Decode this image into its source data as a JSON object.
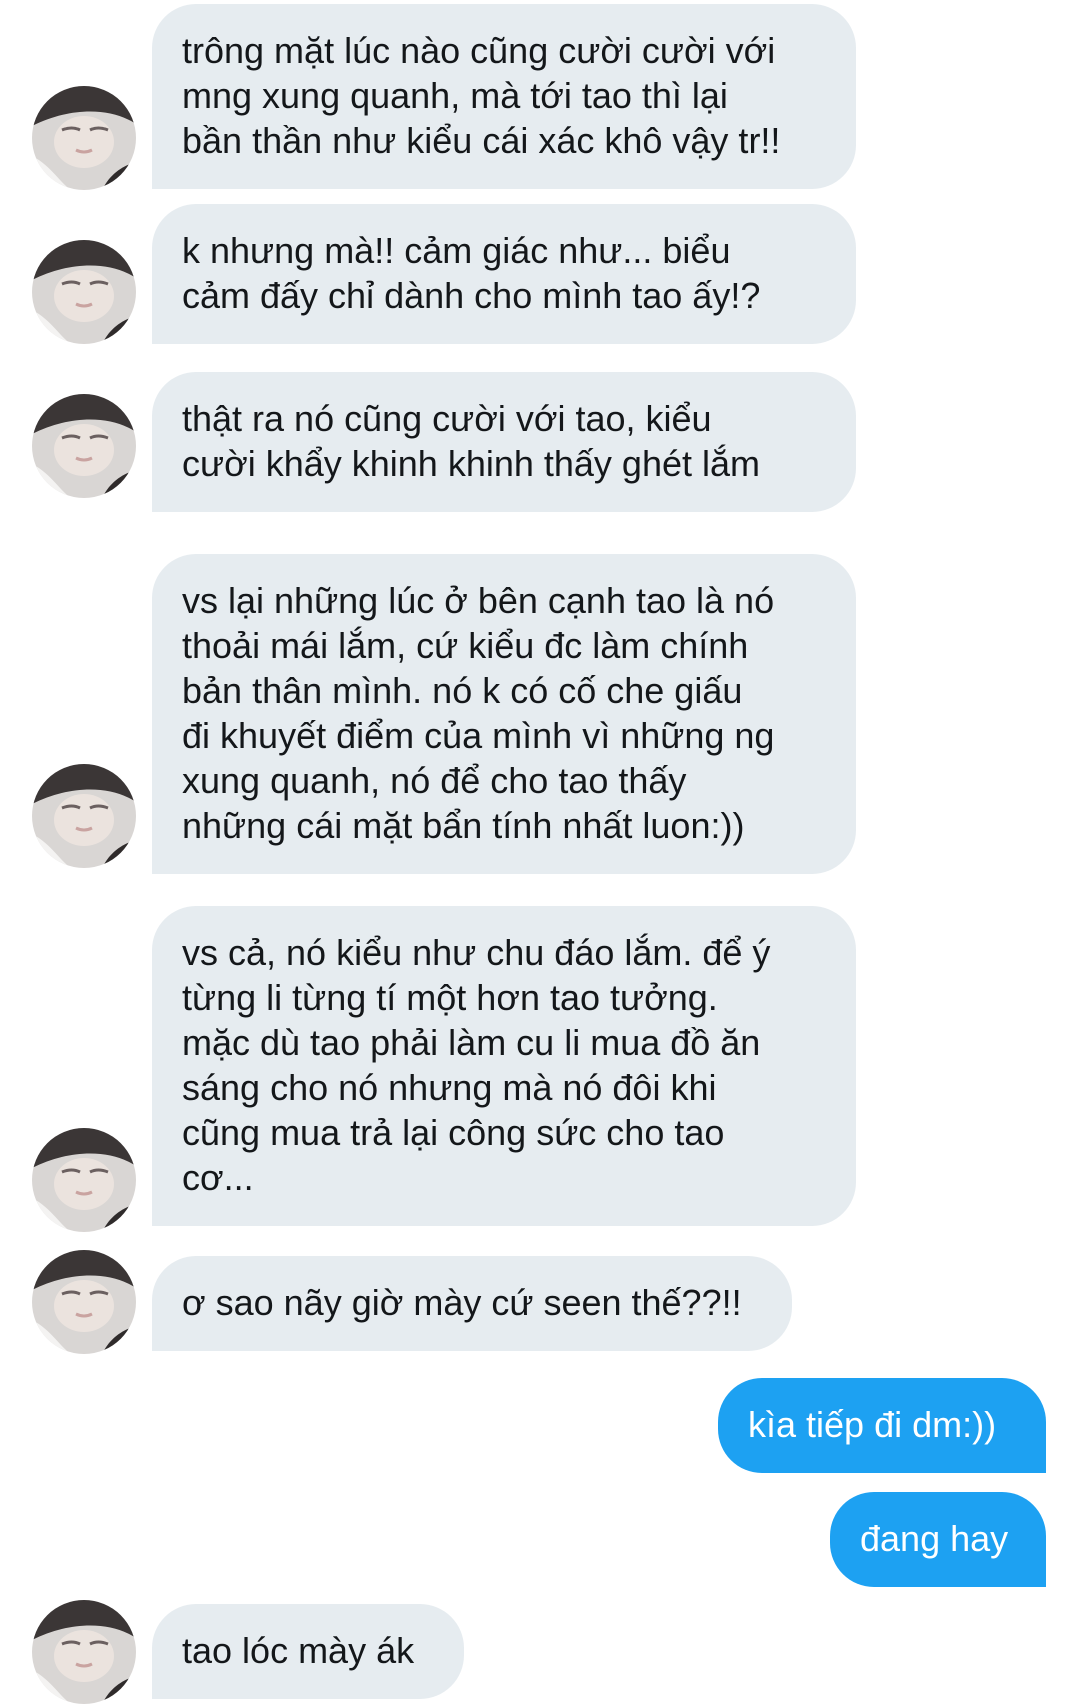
{
  "conversation": {
    "messages": [
      {
        "direction": "received",
        "text": "trông mặt lúc nào cũng cười cười với\nmng xung quanh, mà tới tao thì lại\nbần thần như kiểu cái xác khô vậy tr!!"
      },
      {
        "direction": "received",
        "text": "k nhưng mà!! cảm giác như... biểu\ncảm đấy chỉ dành cho mình tao ấy!?"
      },
      {
        "direction": "received",
        "text": "thật ra nó cũng cười với tao, kiểu\ncười khẩy khinh khinh thấy ghét lắm"
      },
      {
        "direction": "received",
        "text": "vs lại những lúc ở bên cạnh tao là nó\nthoải mái lắm, cứ kiểu đc làm chính\nbản thân mình. nó k có cố che giấu\nđi khuyết điểm của mình vì những ng\nxung quanh, nó để cho tao thấy\nnhững cái mặt bẩn tính nhất luon:))"
      },
      {
        "direction": "received",
        "text": "vs cả, nó kiểu như chu đáo lắm. để ý\ntừng li từng tí một hơn tao tưởng.\nmặc dù tao phải làm cu li mua đồ ăn\nsáng cho nó nhưng mà nó đôi khi\ncũng mua trả lại công sức cho tao\ncơ..."
      },
      {
        "direction": "received",
        "text": "ơ sao nãy giờ mày cứ seen thế??!!"
      },
      {
        "direction": "sent",
        "text": "kìa tiếp đi dm:))"
      },
      {
        "direction": "sent",
        "text": "đang hay"
      },
      {
        "direction": "received",
        "text": "tao lóc mày ák"
      }
    ]
  },
  "colors": {
    "received_bubble": "#e6ecf0",
    "sent_bubble": "#1da1f2",
    "received_text": "#14171a",
    "sent_text": "#ffffff"
  },
  "icons": {
    "avatar": "contact-avatar-photo"
  }
}
